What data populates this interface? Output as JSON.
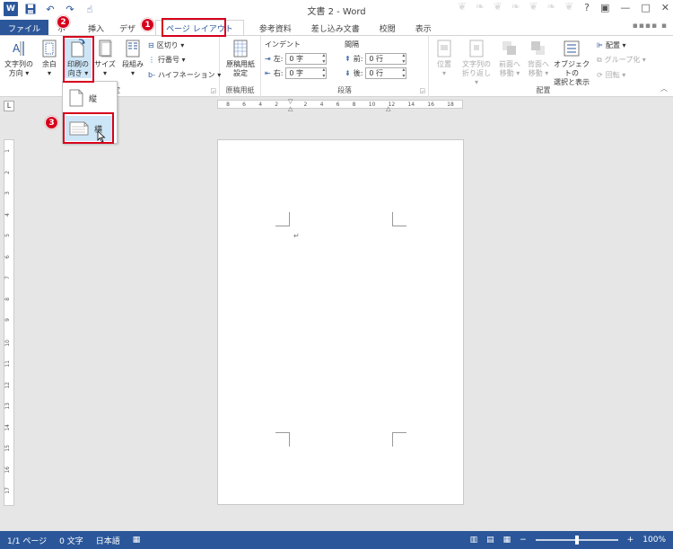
{
  "window": {
    "title": "文書 2 - Word",
    "account": "▪▪▪▪ ▪"
  },
  "qat": {
    "icons": [
      "word-logo",
      "save-icon",
      "undo-icon",
      "redo-icon",
      "touch-mode-icon"
    ]
  },
  "win_controls": {
    "help": "?",
    "restore": "▣",
    "minimize": "—",
    "maximize": "□",
    "close": "✕"
  },
  "tabs": [
    {
      "label": "ファイル"
    },
    {
      "label": "ホ"
    },
    {
      "label": "挿入"
    },
    {
      "label": "デザ"
    },
    {
      "label": "ページ レイアウト"
    },
    {
      "label": "参考資料"
    },
    {
      "label": "差し込み文書"
    },
    {
      "label": "校閲"
    },
    {
      "label": "表示"
    }
  ],
  "ribbon": {
    "page_setup": {
      "text_direction": "文字列の\n方向 ▾",
      "margins": "余白\n▾",
      "orientation": "印刷の\n向き ▾",
      "size": "サイズ\n▾",
      "columns": "段組み\n▾",
      "breaks": "区切り ▾",
      "line_numbers": "行番号 ▾",
      "hyphenation": "ハイフネーション ▾",
      "group_label": "定"
    },
    "manuscript": {
      "button": "原稿用紙\n設定",
      "group_label": "原稿用紙"
    },
    "paragraph": {
      "indent_label": "インデント",
      "spacing_label": "間隔",
      "left_label": "左:",
      "left_value": "0 字",
      "right_label": "右:",
      "right_value": "0 字",
      "before_label": "前:",
      "before_value": "0 行",
      "after_label": "後:",
      "after_value": "0 行",
      "group_label": "段落"
    },
    "arrange": {
      "position": "位置\n▾",
      "wrap_text": "文字列の\n折り返し ▾",
      "bring_forward": "前面へ\n移動 ▾",
      "send_backward": "背面へ\n移動 ▾",
      "selection_pane": "オブジェクトの\n選択と表示",
      "align": "配置 ▾",
      "group": "グループ化 ▾",
      "rotate": "回転 ▾",
      "group_label": "配置"
    }
  },
  "dropdown": {
    "portrait": "縦",
    "landscape": "横"
  },
  "badges": {
    "b1": "1",
    "b2": "2",
    "b3": "3"
  },
  "ruler": {
    "corner": "L",
    "h_ticks": [
      "8",
      "6",
      "4",
      "2",
      "",
      "2",
      "4",
      "6",
      "8",
      "10",
      "12",
      "14",
      "16",
      "18"
    ],
    "v_ticks": [
      "1",
      "2",
      "3",
      "4",
      "5",
      "6",
      "7",
      "8",
      "9",
      "10",
      "11",
      "12",
      "13",
      "14",
      "15",
      "16",
      "17"
    ]
  },
  "document": {
    "paragraph_mark": "↵"
  },
  "status": {
    "page": "1/1 ページ",
    "words": "0 文字",
    "language": "日本語",
    "zoom_minus": "−",
    "zoom_plus": "+",
    "zoom": "100%"
  }
}
